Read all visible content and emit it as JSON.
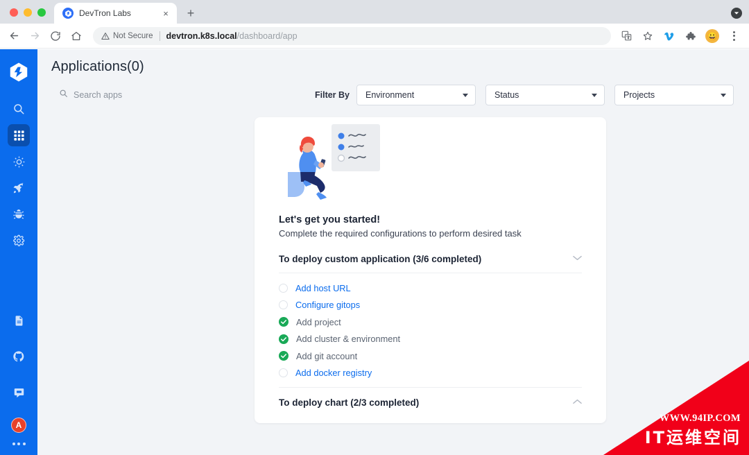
{
  "browser": {
    "tab": {
      "title": "DevTron Labs",
      "favicon": "devtron-logo-icon",
      "close": "×"
    },
    "new_tab_label": "+",
    "nav": {
      "back": "←",
      "forward": "→",
      "reload": "⟳",
      "home": "⌂"
    },
    "omnibox": {
      "security_label": "Not Secure",
      "url_host": "devtron.k8s.local",
      "url_path": "/dashboard/app"
    },
    "toolbar_icons": [
      "translate-icon",
      "bookmark-star-icon",
      "vimeo-extension-icon",
      "extensions-puzzle-icon",
      "profile-avatar-icon",
      "chrome-menu-icon"
    ],
    "profile_emoji": "😀"
  },
  "sidebar": {
    "logo": "devtron-logo",
    "items": [
      {
        "name": "search",
        "icon": "search-icon",
        "active": false
      },
      {
        "name": "applications",
        "icon": "grid-apps-icon",
        "active": true
      },
      {
        "name": "chart-store",
        "icon": "chart-sun-icon",
        "active": false
      },
      {
        "name": "deployments",
        "icon": "rocket-icon",
        "active": false
      },
      {
        "name": "security",
        "icon": "bug-icon",
        "active": false
      },
      {
        "name": "global-configurations",
        "icon": "gear-icon",
        "active": false
      }
    ],
    "bottom_items": [
      {
        "name": "documentation",
        "icon": "document-icon"
      },
      {
        "name": "github",
        "icon": "github-icon"
      },
      {
        "name": "discord-chat",
        "icon": "chat-icon"
      },
      {
        "name": "user-avatar",
        "icon": "avatar-icon",
        "label": "A"
      },
      {
        "name": "more-options",
        "icon": "ellipsis-icon"
      }
    ]
  },
  "main": {
    "page_title": "Applications(0)",
    "search": {
      "placeholder": "Search apps",
      "value": "",
      "icon": "search-icon"
    },
    "filter_label": "Filter By",
    "filters": [
      {
        "name": "environment",
        "value": "Environment"
      },
      {
        "name": "status",
        "value": "Status"
      },
      {
        "name": "projects",
        "value": "Projects"
      }
    ]
  },
  "card": {
    "illustration": "person-with-checklist-illustration",
    "headline": "Let's get you started!",
    "subline": "Complete the required configurations to perform desired task",
    "sections": [
      {
        "title": "To deploy custom application (3/6 completed)",
        "chevron": "chevron-down-icon",
        "items": [
          {
            "label": "Add host URL",
            "done": false
          },
          {
            "label": "Configure gitops",
            "done": false
          },
          {
            "label": "Add project",
            "done": true
          },
          {
            "label": "Add cluster & environment",
            "done": true
          },
          {
            "label": "Add git account",
            "done": true
          },
          {
            "label": "Add docker registry",
            "done": false
          }
        ]
      },
      {
        "title": "To deploy chart (2/3 completed)",
        "chevron": "chevron-up-icon",
        "items": []
      }
    ]
  },
  "watermark": {
    "url": "WWW.94IP.COM",
    "text": "IT运维空间",
    "color": "#f10019"
  },
  "colors": {
    "brand_blue": "#0b6ced",
    "sidebar_active": "#0a4fae",
    "link_blue": "#0b6ced",
    "done_green": "#19a957",
    "page_bg": "#f2f4f7"
  }
}
